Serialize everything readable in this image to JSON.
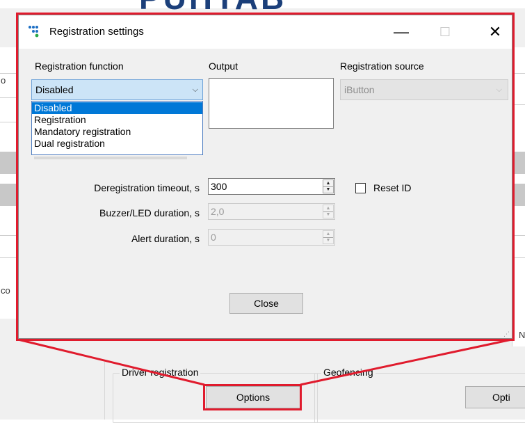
{
  "background_app": {
    "brand_text": "PUHTAB",
    "left_letters": [
      "o",
      "co"
    ],
    "right_letters": [
      "N"
    ],
    "groups": {
      "driver_registration": "Driver registration",
      "geofencing": "Geofencing"
    },
    "buttons": {
      "options": "Options",
      "options_cut": "Opti"
    }
  },
  "dialog": {
    "title": "Registration settings",
    "titlebar_buttons": {
      "minimize": "—",
      "maximize": "☐",
      "close": "✕"
    },
    "registration_function": {
      "label": "Registration function",
      "selected": "Disabled",
      "options": [
        "Disabled",
        "Registration",
        "Mandatory registration",
        "Dual registration"
      ]
    },
    "output": {
      "label": "Output"
    },
    "registration_source": {
      "label": "Registration source",
      "selected": "iButton"
    },
    "deregistration_timeout": {
      "label": "Deregistration timeout, s",
      "value": "300"
    },
    "buzzer_led_duration": {
      "label": "Buzzer/LED duration, s",
      "value": "2,0"
    },
    "alert_duration": {
      "label": "Alert duration, s",
      "value": "0"
    },
    "reset_id": {
      "label": "Reset ID",
      "checked": false
    },
    "close_button": "Close"
  },
  "colors": {
    "highlight_frame": "#e01b2d",
    "selection_blue": "#0078d7",
    "combo_focus_bg": "#cce4f7"
  }
}
